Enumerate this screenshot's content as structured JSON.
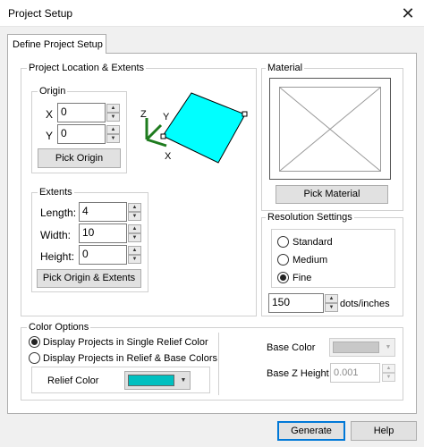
{
  "window": {
    "title": "Project Setup",
    "close_glyph": "✕"
  },
  "tab": {
    "label": "Define Project Setup"
  },
  "location": {
    "group_label": "Project Location & Extents",
    "origin": {
      "group_label": "Origin",
      "x_label": "X",
      "x_value": "0",
      "y_label": "Y",
      "y_value": "0",
      "button": "Pick Origin"
    },
    "extents": {
      "group_label": "Extents",
      "length_label": "Length:",
      "length_value": "4",
      "width_label": "Width:",
      "width_value": "10",
      "height_label": "Height:",
      "height_value": "0",
      "button": "Pick Origin & Extents"
    },
    "preview": {
      "axis_x": "X",
      "axis_y": "Y",
      "axis_z": "Z",
      "plane_color": "#00ffff",
      "axis_color": "#1e7b1e"
    }
  },
  "material": {
    "group_label": "Material",
    "button": "Pick Material"
  },
  "resolution": {
    "group_label": "Resolution Settings",
    "options": [
      "Standard",
      "Medium",
      "Fine"
    ],
    "selected": "Fine",
    "value": "150",
    "unit": "dots/inches"
  },
  "color_options": {
    "group_label": "Color Options",
    "option_single": "Display Projects in Single Relief Color",
    "option_relief_base": "Display Projects in Relief & Base Colors",
    "selected": "single",
    "relief_color_label": "Relief Color",
    "relief_color": "#00c0c0",
    "base_color_label": "Base Color",
    "base_color": "#c8c8c8",
    "base_z_label": "Base Z Height",
    "base_z_value": "0.001"
  },
  "buttons": {
    "generate": "Generate",
    "help": "Help"
  }
}
